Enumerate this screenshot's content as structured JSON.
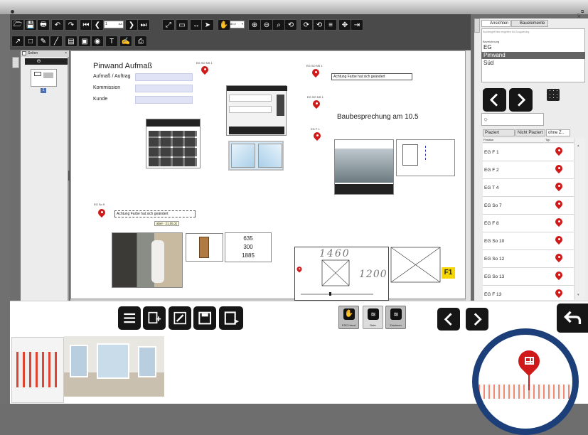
{
  "toolbar": {
    "zoom_value": "80,0",
    "page_field_value": "1",
    "page_field_suffix": "AA"
  },
  "pages_panel": {
    "title": "Seiten",
    "page_badge": "1"
  },
  "canvas": {
    "heading": "Pinwand Aufmaß",
    "form_labels": [
      "Aufmaß / Auftrag",
      "Kommission",
      "Kunde"
    ],
    "meeting_text": "Baubesprechung am 10.5",
    "note_text": "Achtung Farbe hat sich geändert",
    "note_tooltip": "abel - 21.05.2(",
    "pin_labels": {
      "p1": "EG SO NS 1",
      "p2": "EG SO NS 1",
      "p3": "EG SO NS 1",
      "p4": "EG F 1",
      "p5": "EG So 9"
    },
    "measures": [
      "635",
      "300",
      "1885"
    ],
    "sketch": {
      "top": "1460",
      "side": "1200"
    },
    "f1_badge": "F1"
  },
  "right_panel": {
    "tabs": [
      "Ansichten",
      "Bauelemente"
    ],
    "search_hint": "Suchbegriff hier eingeben für Gruppierung",
    "list_header": "Bezeichnung",
    "views": [
      "EG",
      "Pinwand",
      "Süd"
    ],
    "selected_view": "Pinwand",
    "search_placeholder": "Q-",
    "filter_tabs": [
      "Plaziert",
      "Nicht Plaziert",
      "ohne Z.."
    ],
    "col_position": "Position",
    "col_type": "Typ",
    "elements": [
      "EG F 1",
      "EG F 2",
      "EG T 4",
      "EG So 7",
      "EG F 8",
      "EG So 10",
      "EG So 12",
      "EG So 13",
      "EG F 13"
    ]
  },
  "bottom_bar": {
    "mode_labels": [
      "ESC,Hand",
      "Date",
      "Zeichnen"
    ]
  },
  "colors": {
    "toolbar_bg": "#151515",
    "pin_red": "#d01a1a",
    "selected_row": "#646464",
    "f1_yellow": "#f5d600",
    "lens_blue": "#1c3f7a"
  }
}
